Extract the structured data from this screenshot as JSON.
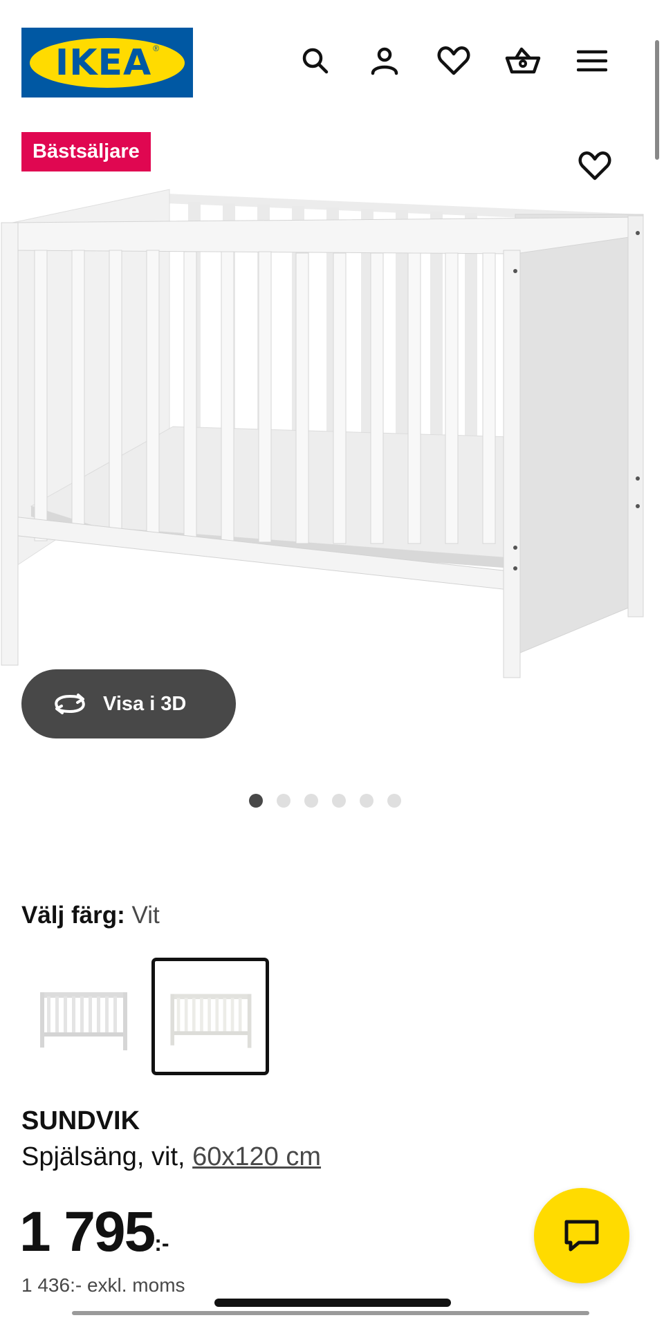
{
  "header": {
    "logo_text": "IKEA",
    "logo_reg": "®",
    "icons": [
      "search-icon",
      "user-icon",
      "heart-icon",
      "basket-icon",
      "menu-icon"
    ]
  },
  "badge": {
    "label": "Bästsäljare"
  },
  "gallery": {
    "view3d_label": "Visa i 3D",
    "image_count": 6,
    "active_index": 0
  },
  "color": {
    "label": "Välj färg:",
    "value": "Vit",
    "swatches": 2,
    "selected_index": 1
  },
  "product": {
    "name": "SUNDVIK",
    "desc_prefix": "Spjälsäng, vit, ",
    "size_link": "60x120 cm",
    "price_main": "1 795",
    "price_suffix": ":-",
    "price_ex_vat": "1 436:- exkl. moms"
  },
  "colors": {
    "ikea_blue": "#0058A3",
    "ikea_yellow": "#FFDB00",
    "badge_red": "#E00751",
    "dark_button": "#484848"
  }
}
